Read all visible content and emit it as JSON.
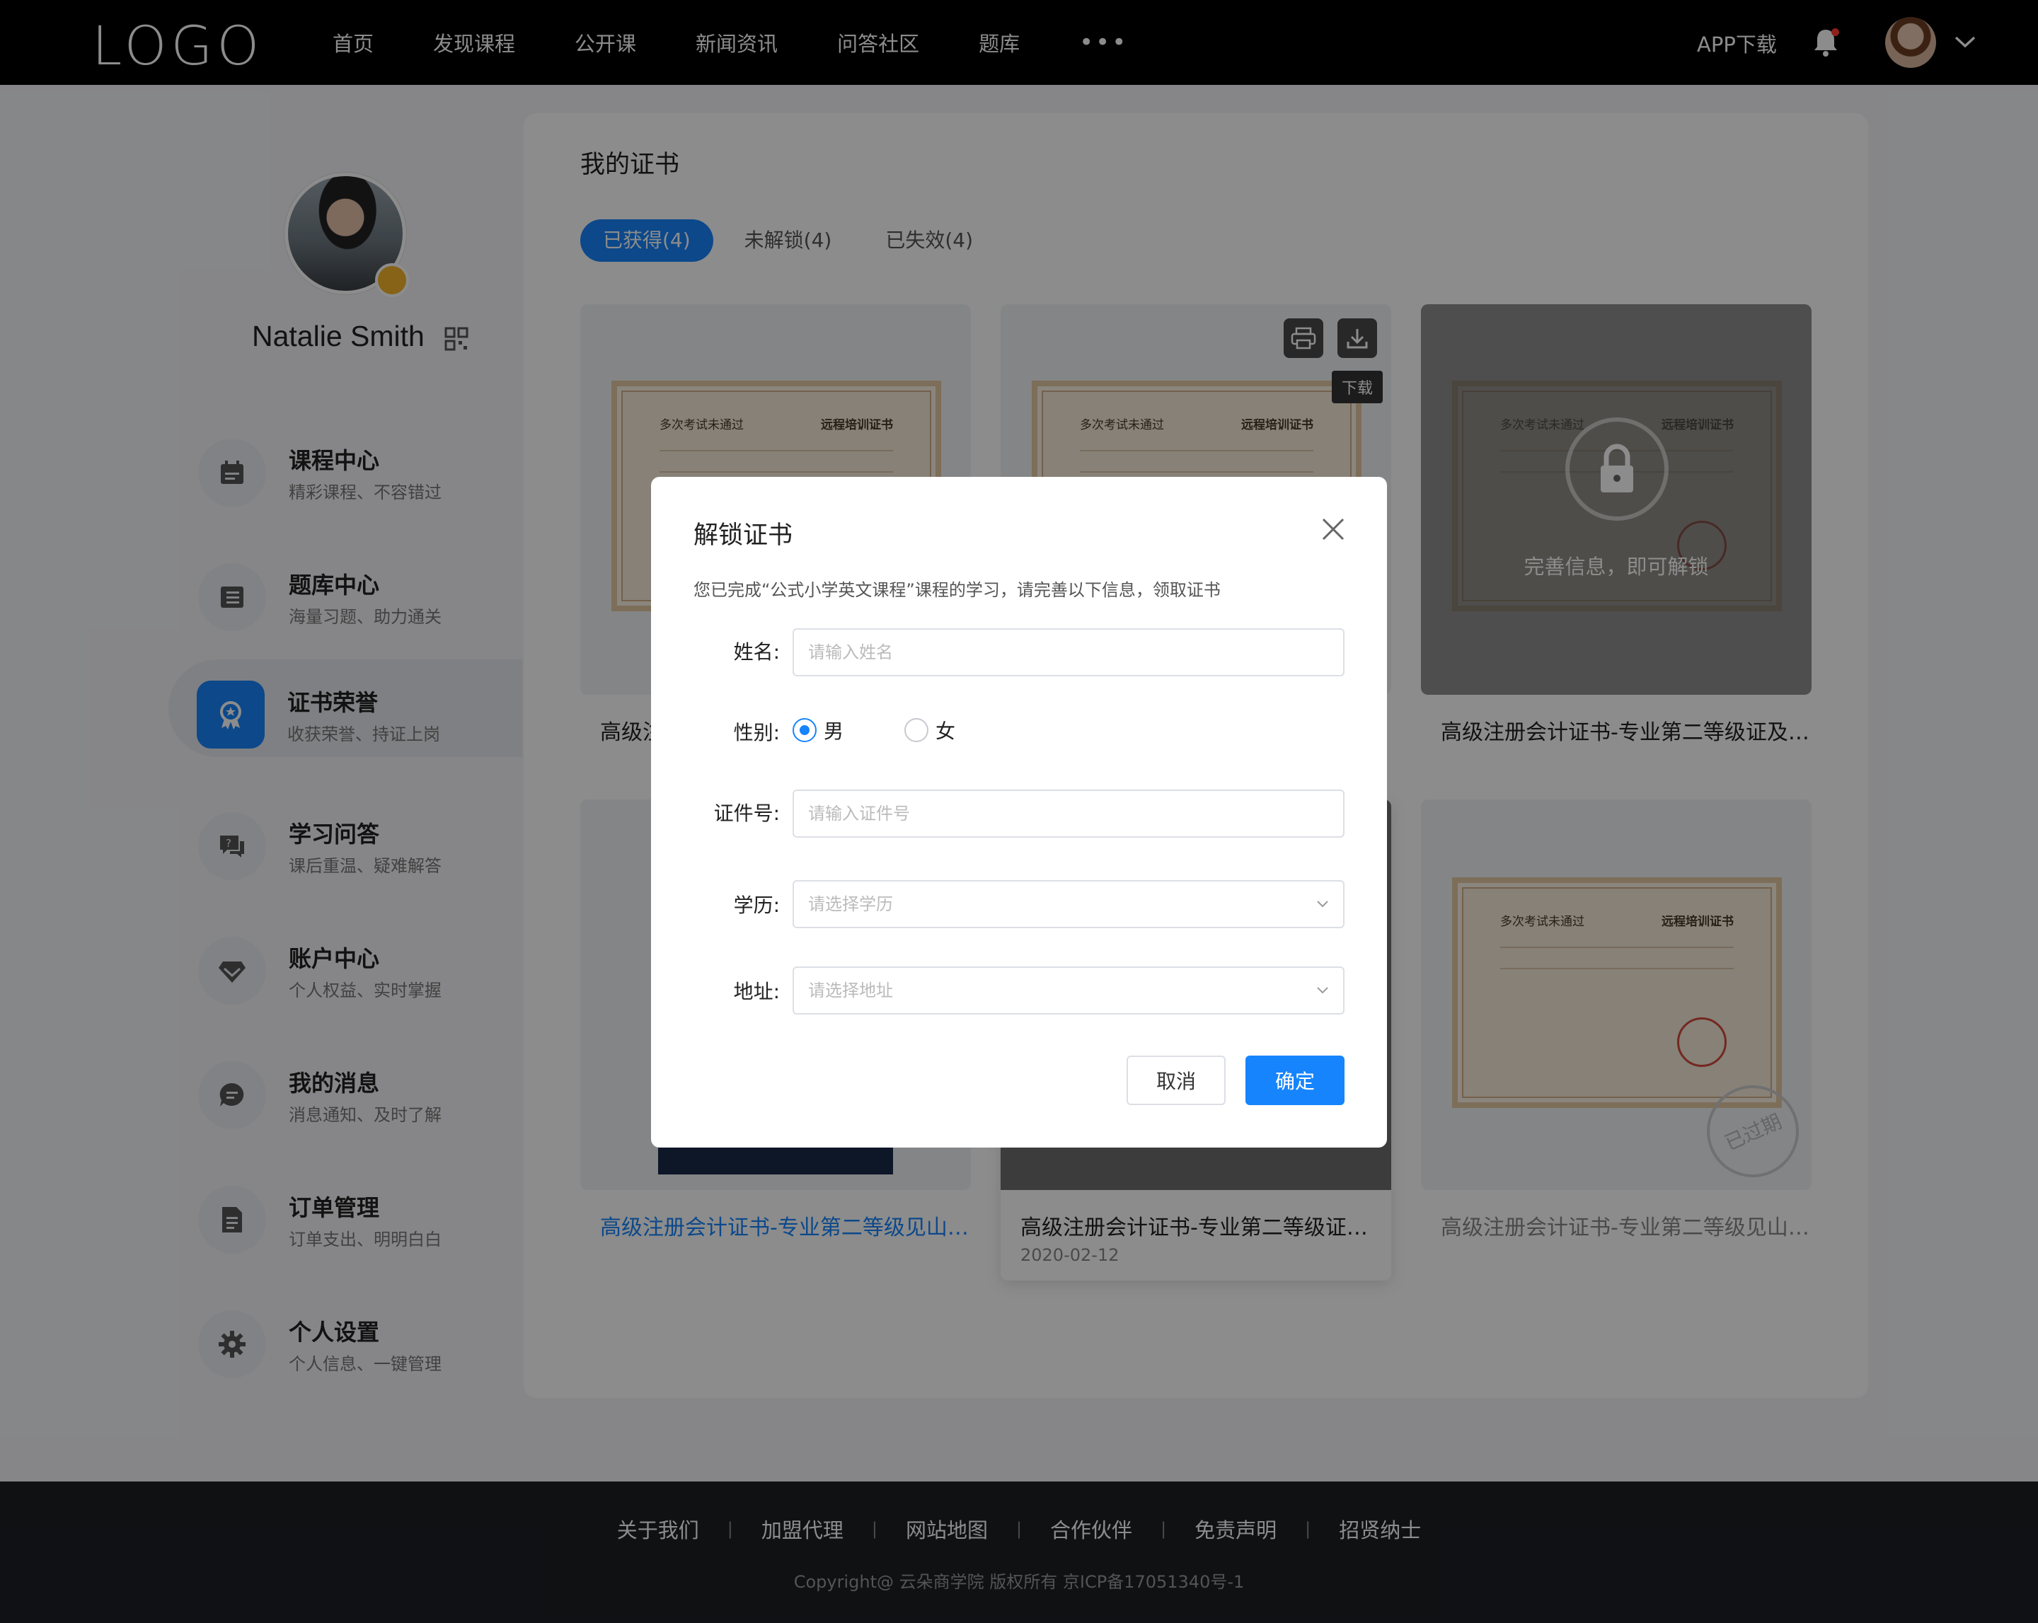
{
  "header": {
    "logo": "LOGO",
    "nav": [
      "首页",
      "发现课程",
      "公开课",
      "新闻资讯",
      "问答社区",
      "题库"
    ],
    "more": "•••",
    "app_download": "APP下载"
  },
  "profile": {
    "name": "Natalie Smith"
  },
  "sidebar": {
    "items": [
      {
        "title": "课程中心",
        "sub": "精彩课程、不容错过",
        "icon": "calendar-icon"
      },
      {
        "title": "题库中心",
        "sub": "海量习题、助力通关",
        "icon": "list-icon"
      },
      {
        "title": "证书荣誉",
        "sub": "收获荣誉、持证上岗",
        "icon": "award-icon"
      },
      {
        "title": "学习问答",
        "sub": "课后重温、疑难解答",
        "icon": "qa-icon"
      },
      {
        "title": "账户中心",
        "sub": "个人权益、实时掌握",
        "icon": "diamond-icon"
      },
      {
        "title": "我的消息",
        "sub": "消息通知、及时了解",
        "icon": "message-icon"
      },
      {
        "title": "订单管理",
        "sub": "订单支出、明明白白",
        "icon": "document-icon"
      },
      {
        "title": "个人设置",
        "sub": "个人信息、一键管理",
        "icon": "gear-icon"
      }
    ],
    "active_index": 2
  },
  "main": {
    "title": "我的证书",
    "tabs": [
      "已获得(4)",
      "未解锁(4)",
      "已失效(4)"
    ],
    "cert_text": {
      "left": "多次考试未通过",
      "right": "远程培训证书"
    },
    "cards": [
      {
        "caption": "高级注"
      },
      {
        "caption": ""
      },
      {
        "caption": "高级注册会计证书-专业第二等级证及…",
        "locked_text": "完善信息，即可解锁"
      },
      {
        "caption": "高级注册会计证书-专业第二等级见山…"
      },
      {
        "caption": "高级注册会计证书-专业第二等级证…",
        "date": "2020-02-12"
      },
      {
        "caption": "高级注册会计证书-专业第二等级见山…",
        "stamp": "已过期"
      }
    ],
    "tooltip": "下载"
  },
  "modal": {
    "title": "解锁证书",
    "desc": "您已完成“公式小学英文课程”课程的学习，请完善以下信息，领取证书",
    "name_label": "姓名:",
    "name_placeholder": "请输入姓名",
    "gender_label": "性别:",
    "gender_options": [
      "男",
      "女"
    ],
    "gender_selected": "男",
    "id_label": "证件号:",
    "id_placeholder": "请输入证件号",
    "edu_label": "学历:",
    "edu_placeholder": "请选择学历",
    "addr_label": "地址:",
    "addr_placeholder": "请选择地址",
    "cancel": "取消",
    "confirm": "确定"
  },
  "footer": {
    "links": [
      "关于我们",
      "加盟代理",
      "网站地图",
      "合作伙伴",
      "免责声明",
      "招贤纳士"
    ],
    "separator": "|",
    "copyright": "Copyright@ 云朵商学院   版权所有      京ICP备17051340号-1"
  },
  "colors": {
    "accent": "#1684fc",
    "header_bg": "#000000",
    "footer_bg": "#1e1f24"
  }
}
